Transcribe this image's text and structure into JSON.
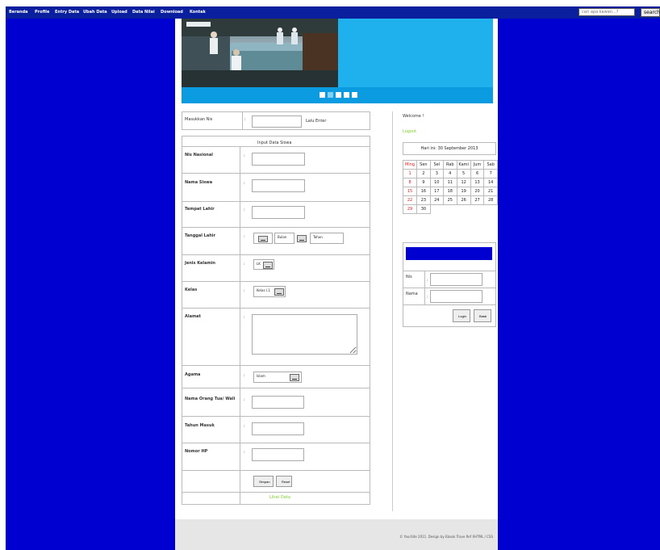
{
  "nav": {
    "items": [
      "Beranda",
      "Profile",
      "Entry Data",
      "Ubah Data",
      "Upload",
      "Data Nilai",
      "Download",
      "Kontak"
    ]
  },
  "search": {
    "placeholder": "cari apa kawan...?",
    "button": "search"
  },
  "banner": {
    "dot_count": 5,
    "active_dot": 1
  },
  "nis_search": {
    "label": "Masukkan Nis",
    "colon": ":",
    "hint": "Lalu Enter"
  },
  "form": {
    "title": "Input Data Siswa",
    "fields": {
      "nisn": "Nis Nasional",
      "nama": "Nama Siswa",
      "tempat": "Tempat Lahir",
      "tanggal": "Tanggal Lahir",
      "jk": "Jenis Kelamin",
      "kelas": "Kelas",
      "alamat": "Alamat",
      "agama": "Agama",
      "ortu": "Nama Orang Tua/ Wali",
      "tahun": "Tahun Masuk",
      "hp": "Nomor HP"
    },
    "tanggal_bulan": "Bulan",
    "tanggal_tahun": "Tahun",
    "jk_value": "LK",
    "kelas_value": "Kelas I.1",
    "agama_value": "Islam",
    "simpan": "Simpan",
    "reset": "Reset",
    "lihat": "Lihat Data"
  },
  "sidebar": {
    "welcome": "Welcome !",
    "logout": "Logout",
    "date": "Hari ini: 30 September 2013",
    "calendar": {
      "headers": [
        "Ming",
        "Sen",
        "Sel",
        "Rab",
        "Kami",
        "Jum",
        "Sab"
      ],
      "rows": [
        [
          "1",
          "2",
          "3",
          "4",
          "5",
          "6",
          "7"
        ],
        [
          "8",
          "9",
          "10",
          "11",
          "12",
          "13",
          "14"
        ],
        [
          "15",
          "16",
          "17",
          "18",
          "19",
          "20",
          "21"
        ],
        [
          "22",
          "23",
          "24",
          "25",
          "26",
          "27",
          "28"
        ],
        [
          "29",
          "30",
          "",
          "",
          "",
          "",
          ""
        ]
      ]
    },
    "login": {
      "nis_label": "Nis",
      "nama_label": "Nama",
      "colon": ":",
      "login_btn": "Login",
      "batal_btn": "Batal",
      "header_color": "#0000d0"
    }
  },
  "footer": {
    "text": "© YourSite 2011. Design by Ebook Trave Ref XHTML / CSS"
  }
}
